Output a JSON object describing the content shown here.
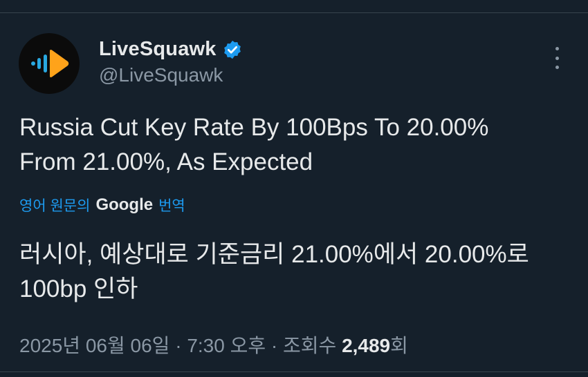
{
  "author": {
    "display_name": "LiveSquawk",
    "handle": "@LiveSquawk",
    "verified_icon": "verified-badge-icon",
    "avatar_icon": "livesquawk-logo-icon"
  },
  "tweet": {
    "text_line1": "Russia Cut Key Rate By 100Bps To 20.00%",
    "text_line2": "From 21.00%, As Expected"
  },
  "translation": {
    "prefix": "영어 원문의",
    "provider": "Google",
    "suffix": "번역",
    "text_line1": "러시아, 예상대로 기준금리 21.00%에서 20.00%로",
    "text_line2": "100bp 인하"
  },
  "meta": {
    "date": "2025년 06월 06일",
    "separator": "·",
    "time": "7:30 오후",
    "views_label": "조회수",
    "views_count": "2,489",
    "views_suffix": "회"
  },
  "colors": {
    "background": "#15202b",
    "accent": "#1d9bf0",
    "logo_orange": "#ffa31a",
    "logo_blue": "#29a8e0"
  }
}
